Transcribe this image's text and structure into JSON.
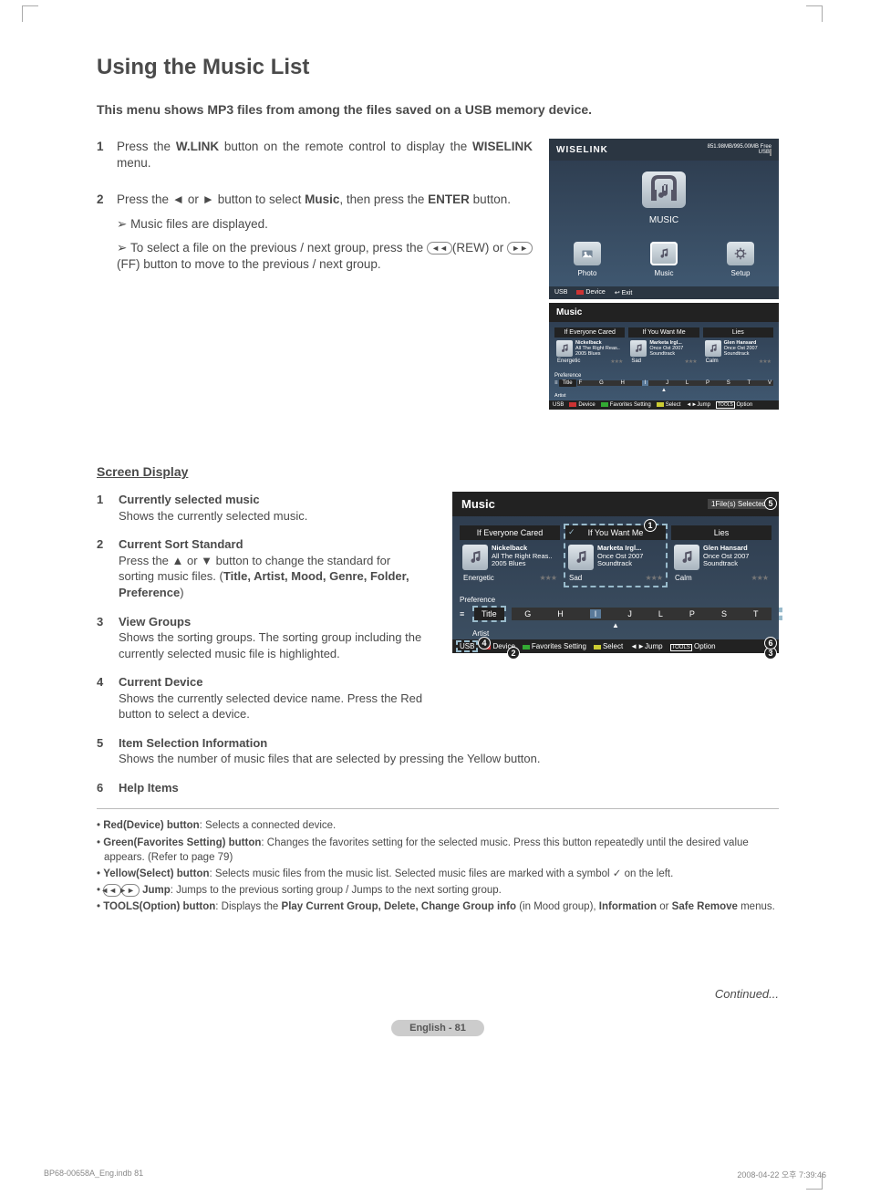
{
  "heading": "Using the Music List",
  "subtitle": "This menu shows MP3 files from among the files saved on a USB memory device.",
  "steps": [
    {
      "num": "1",
      "html_prefix": "Press the ",
      "b1": "W.LINK",
      "mid1": " button on the remote control to display the ",
      "b2": "WISELINK",
      "suffix": " menu."
    },
    {
      "num": "2",
      "p1a": "Press the ◄ or ► button to select ",
      "p1b": "Music",
      "p1c": ", then press the ",
      "p1d": "ENTER",
      "p1e": " button.",
      "sub1": "Music files are displayed.",
      "sub2a": "To select a file on the previous / next group, press the ",
      "sub2b": "(REW) or ",
      "sub2c": "(FF) button to move to the previous / next group."
    }
  ],
  "wiselink": {
    "title": "WISELINK",
    "usb_label": "USB",
    "usb_free": "851.98MB/995.00MB Free",
    "big_label": "MUSIC",
    "cats": [
      "Photo",
      "Music",
      "Setup"
    ],
    "foot_device_label": "Device",
    "foot_exit": "Exit"
  },
  "music_panel": {
    "title": "Music",
    "tracks": [
      {
        "title": "If Everyone Cared",
        "artist": "Nickelback",
        "meta": "All The Right Reas..\n2005\nBlues",
        "mood": "Energetic"
      },
      {
        "title": "If You Want Me",
        "artist": "Marketa Irgl...",
        "meta": "Once Ost\n2007\nSoundtrack",
        "mood": "Sad"
      },
      {
        "title": "Lies",
        "artist": "Glen Hansard",
        "meta": "Once Ost\n2007\nSoundtrack",
        "mood": "Calm"
      }
    ],
    "preference": "Preference",
    "sort_label": "Title",
    "letters": [
      "F",
      "G",
      "H",
      "I",
      "J",
      "L",
      "P",
      "S",
      "T",
      "V"
    ],
    "artist_label": "Artist",
    "foot": {
      "usb": "USB",
      "device": "Device",
      "fav": "Favorites Setting",
      "select": "Select",
      "jump": "Jump",
      "option": "Option"
    }
  },
  "screen_display_title": "Screen Display",
  "sd_items": [
    {
      "n": "1",
      "h": "Currently selected music",
      "d": "Shows the currently selected music."
    },
    {
      "n": "2",
      "h": "Current Sort Standard",
      "d": "Press the ▲ or ▼ button to change the standard for sorting music files. (",
      "db": "Title, Artist, Mood, Genre, Folder, Preference",
      "de": ")"
    },
    {
      "n": "3",
      "h": "View Groups",
      "d": "Shows the sorting groups. The sorting group including the currently selected music file is highlighted."
    },
    {
      "n": "4",
      "h": "Current Device",
      "d": "Shows the currently selected device name. Press the Red button to select a device."
    },
    {
      "n": "5",
      "h": "Item Selection Information",
      "d": "Shows the number of music files that are selected by pressing the Yellow button."
    },
    {
      "n": "6",
      "h": "Help Items",
      "d": ""
    }
  ],
  "anno": {
    "title": "Music",
    "selected": "1File(s) Selected",
    "tracks": [
      {
        "title": "If Everyone Cared",
        "artist": "Nickelback",
        "meta": "All The Right Reas..\n2005\nBlues",
        "mood": "Energetic"
      },
      {
        "title": "If You Want Me",
        "artist": "Marketa Irgl...",
        "meta": "Once Ost\n2007\nSoundtrack",
        "mood": "Sad"
      },
      {
        "title": "Lies",
        "artist": "Glen Hansard",
        "meta": "Once Ost\n2007\nSoundtrack",
        "mood": "Calm"
      }
    ],
    "preference": "Preference",
    "sort_label": "Title",
    "letters": [
      "G",
      "H",
      "I",
      "J",
      "L",
      "P",
      "S",
      "T"
    ],
    "artist_label": "Artist",
    "foot": {
      "usb": "USB",
      "device": "Device",
      "fav": "Favorites Setting",
      "select": "Select",
      "jump": "Jump",
      "option": "Option"
    }
  },
  "help_items": [
    {
      "b": "Red(Device) button",
      "t": ": Selects a connected device."
    },
    {
      "b": "Green(Favorites Setting) button",
      "t": ": Changes the favorites setting for the selected music. Press this button repeatedly until the desired value appears. (Refer to page 79)"
    },
    {
      "b": "Yellow(Select) button",
      "t": ": Selects music files from the music list. Selected music files are marked with a symbol ✓ on the left."
    },
    {
      "b_jump": true,
      "b": "Jump",
      "t": ": Jumps to the previous sorting group / Jumps to the next sorting group."
    },
    {
      "b": "TOOLS(Option) button",
      "t_prefix": ": Displays the ",
      "bolds": "Play Current Group, Delete, Change Group info",
      "mid": " (in Mood group), ",
      "bolds2": "Information",
      "mid2": " or ",
      "bolds3": "Safe Remove",
      "suffix": " menus."
    }
  ],
  "continued": "Continued...",
  "page_label": "English - 81",
  "print_left": "BP68-00658A_Eng.indb   81",
  "print_right": "2008-04-22   오후 7:39:46"
}
